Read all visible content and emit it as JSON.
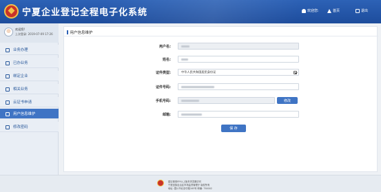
{
  "header": {
    "title": "宁夏企业登记全程电子化系统",
    "user_label": "欢迎您:",
    "home_label": "首页",
    "exit_label": "退出"
  },
  "sidebar": {
    "welcome": "欢迎您!",
    "last_login": "上次登录: 2019-07-09 17:26",
    "items": [
      {
        "label": "业务办理",
        "icon": "briefcase-icon"
      },
      {
        "label": "已办业务",
        "icon": "document-icon"
      },
      {
        "label": "绑定企业",
        "icon": "link-icon"
      },
      {
        "label": "相关业务",
        "icon": "building-icon"
      },
      {
        "label": "云证书申请",
        "icon": "certificate-icon"
      },
      {
        "label": "用户信息维护",
        "icon": "tools-icon",
        "active": true
      },
      {
        "label": "修改密码",
        "icon": "lock-icon"
      }
    ]
  },
  "main": {
    "breadcrumb": "用户信息维护",
    "form": {
      "username_label": "用户名:",
      "name_label": "姓名:",
      "id_type_label": "证件类型:",
      "id_type_value": "中华人民共和国居民身份证",
      "id_number_label": "证件号码:",
      "phone_label": "手机号码:",
      "email_label": "邮箱:",
      "modify_button": "修改",
      "save_button": "保 存"
    }
  },
  "footer": {
    "line1": "建议使用IE9以上版本浏览器访问",
    "line2": "宁夏回族自治区市场监督管理厅 版权所有",
    "line3": "地址: 银川市北京中路165号 邮编: 750002"
  },
  "colors": {
    "header_blue": "#2d62b6",
    "accent_blue": "#3f74c4",
    "sidebar_text": "#2b5a9c"
  }
}
